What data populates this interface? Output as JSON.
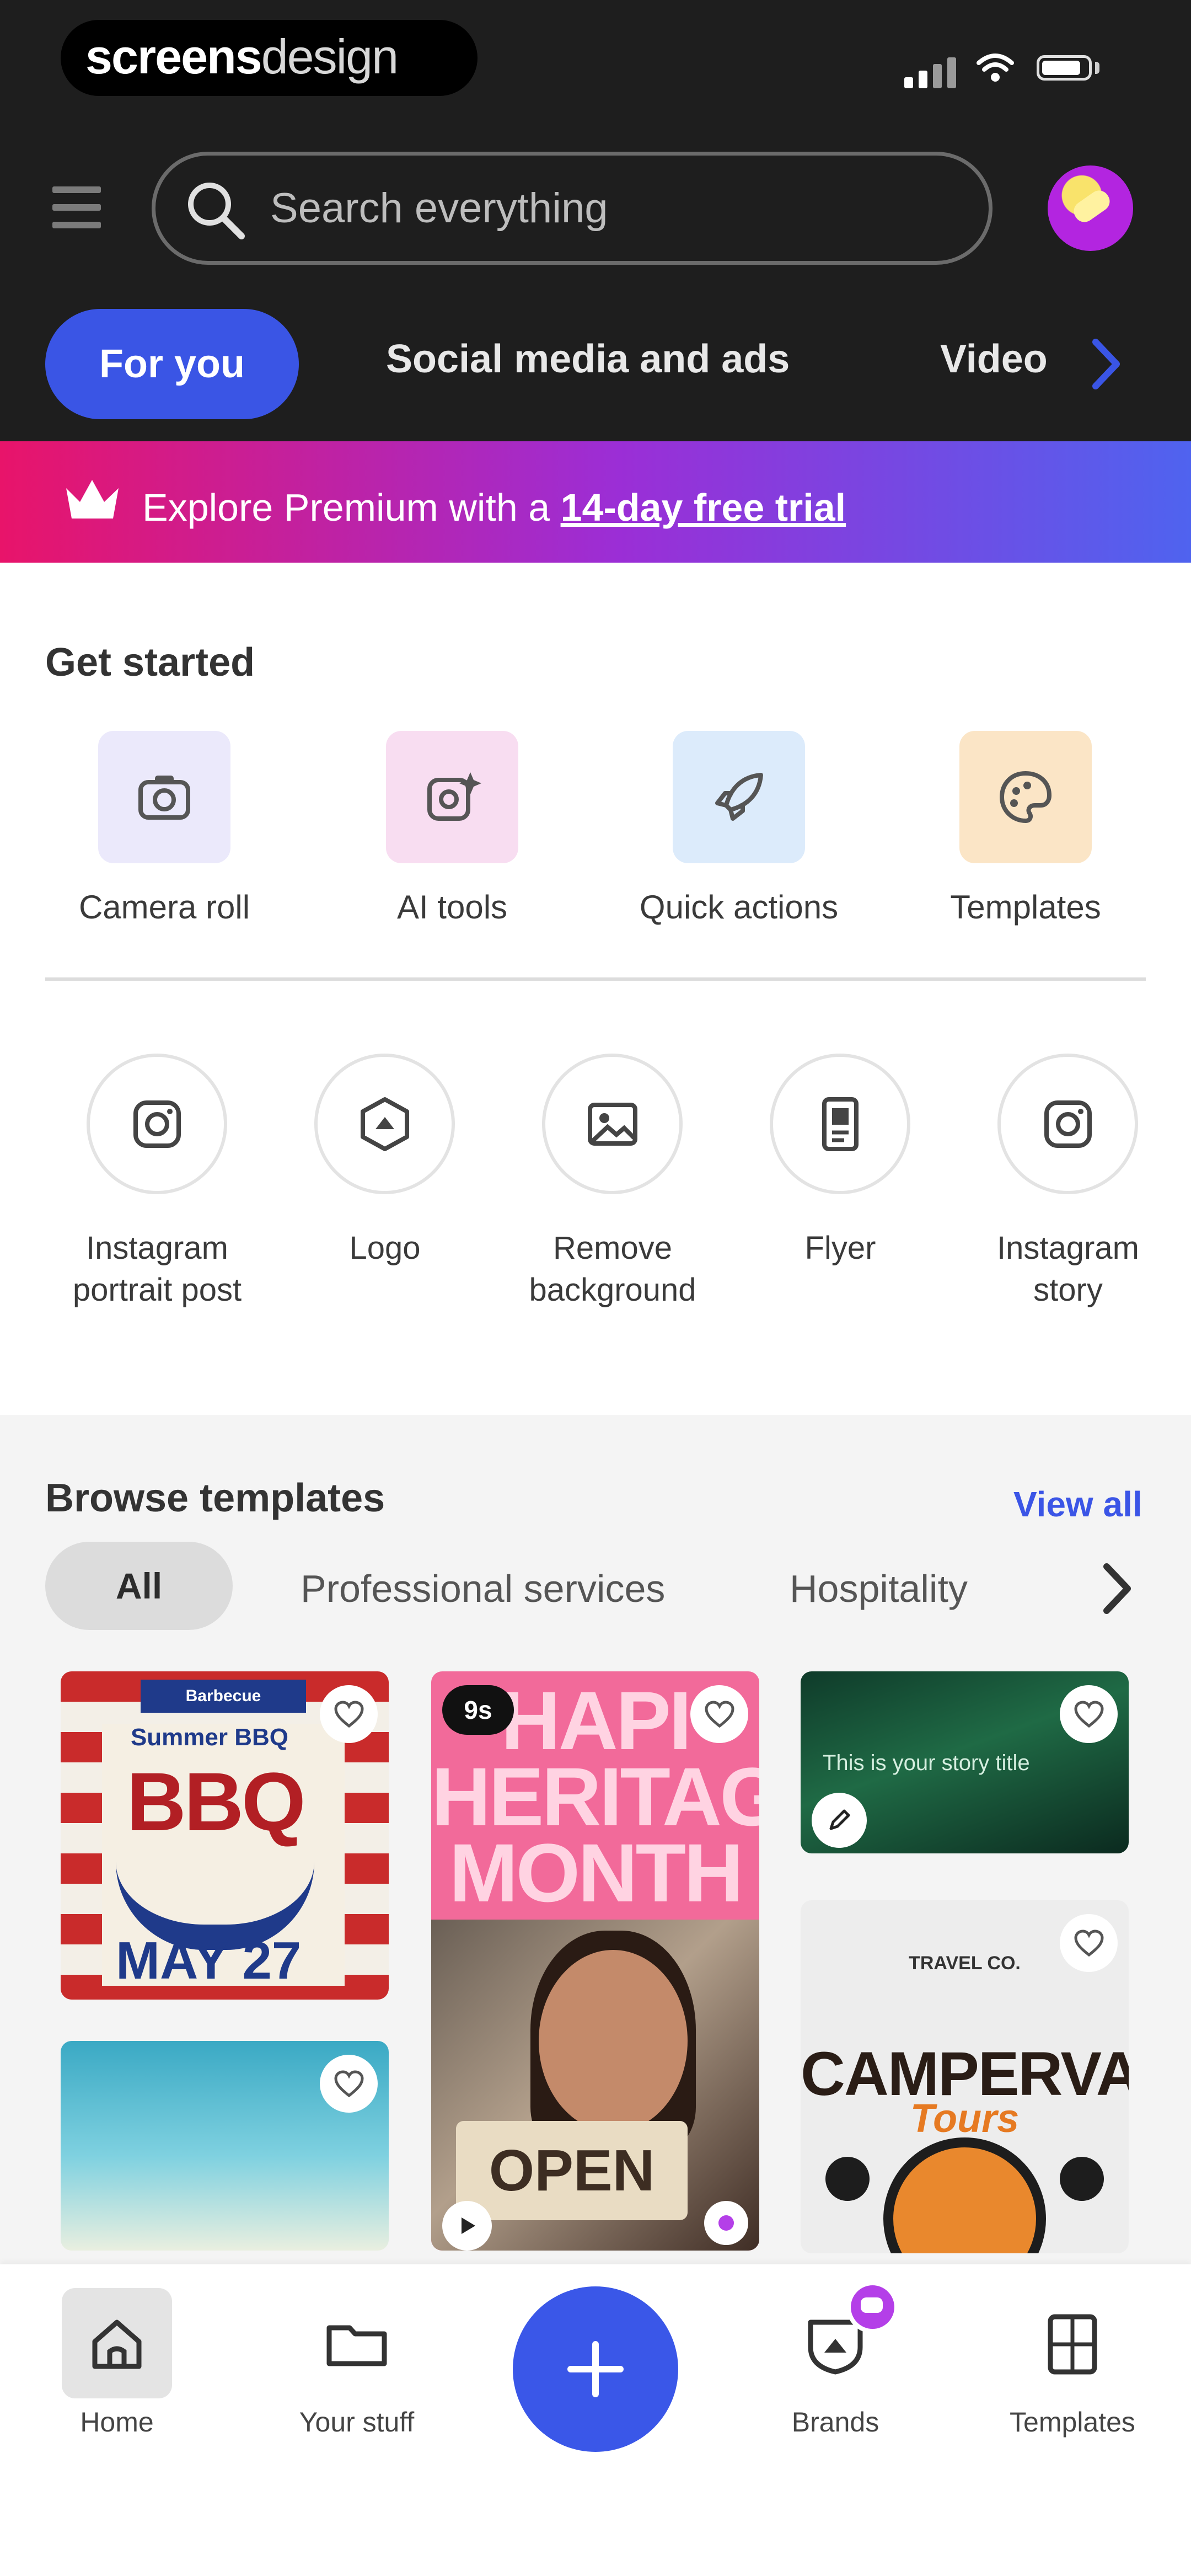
{
  "status_bar": {
    "brand_bold": "screens",
    "brand_light": "design"
  },
  "header": {
    "search_placeholder": "Search everything"
  },
  "category_tabs": [
    {
      "label": "For you",
      "active": true
    },
    {
      "label": "Social media and ads"
    },
    {
      "label": "Video"
    }
  ],
  "premium": {
    "prefix": "Explore Premium with a ",
    "link": "14-day free trial",
    "gradient": [
      "#e8146a",
      "#9b2ed6",
      "#4f63ef"
    ]
  },
  "get_started": {
    "title": "Get started",
    "tiles": [
      {
        "label": "Camera roll",
        "icon": "camera-icon",
        "color": "#ebe9fb"
      },
      {
        "label": "AI tools",
        "icon": "ai-sparkle-icon",
        "color": "#f8ddf1"
      },
      {
        "label": "Quick actions",
        "icon": "rocket-icon",
        "color": "#dcebfb"
      },
      {
        "label": "Templates",
        "icon": "palette-icon",
        "color": "#fbe5c6"
      }
    ],
    "shortcuts": [
      {
        "label": "Instagram portrait post",
        "icon": "instagram-icon"
      },
      {
        "label": "Logo",
        "icon": "logo-icon"
      },
      {
        "label": "Remove background",
        "icon": "remove-background-icon"
      },
      {
        "label": "Flyer",
        "icon": "flyer-icon"
      },
      {
        "label": "Instagram story",
        "icon": "instagram-icon"
      }
    ]
  },
  "browse": {
    "title": "Browse templates",
    "view_all": "View all",
    "filters": [
      {
        "label": "All",
        "active": true
      },
      {
        "label": "Professional services"
      },
      {
        "label": "Hospitality"
      }
    ],
    "cards": {
      "bbq": {
        "tag": "Barbecue",
        "small": "Summer BBQ",
        "big": "BBQ",
        "date": "MAY 27"
      },
      "heritage": {
        "title": "HAPI HERITAGE MONTH",
        "duration": "9s",
        "sign": "OPEN"
      },
      "aurora": {
        "text": "This is your story title"
      },
      "camper": {
        "small": "TRAVEL CO.",
        "title": "CAMPERVAN",
        "sub": "Tours"
      }
    }
  },
  "bottom_nav": [
    {
      "label": "Home",
      "icon": "home-icon",
      "active": true
    },
    {
      "label": "Your stuff",
      "icon": "folder-icon"
    },
    {
      "label": "Brands",
      "icon": "brands-icon"
    },
    {
      "label": "Templates",
      "icon": "templates-icon"
    }
  ],
  "colors": {
    "accent": "#3a55e5",
    "header_bg": "#1e1e1e",
    "link": "#3b55e6"
  }
}
